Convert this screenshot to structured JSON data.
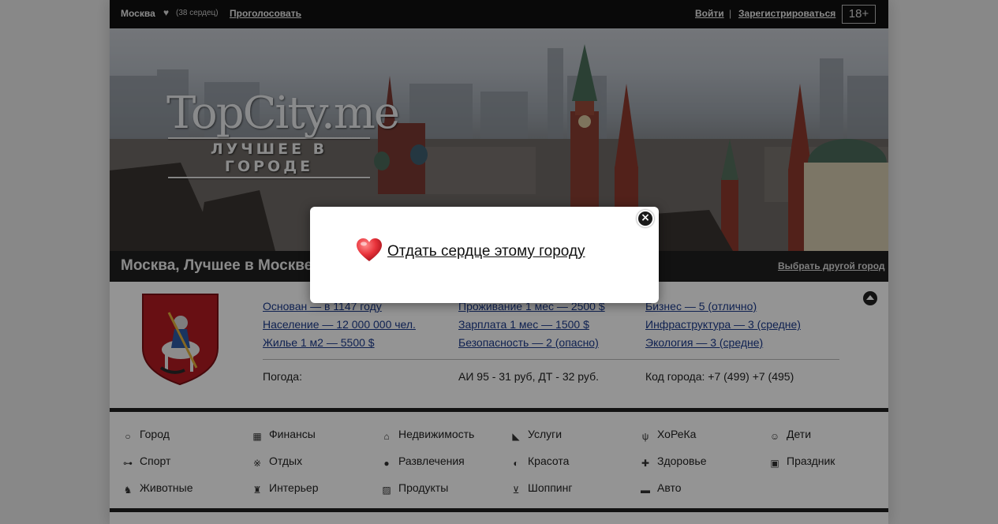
{
  "topbar": {
    "city": "Москва",
    "heart_icon": "heart-icon",
    "hearts_count": "(38 сердец)",
    "vote": "Проголосовать",
    "login": "Войти",
    "separator": "|",
    "register": "Зарегистрироваться",
    "age_badge": "18+"
  },
  "banner": {
    "logo_title": "TopCity.me",
    "logo_subtitle": "ЛУЧШЕЕ В ГОРОДЕ"
  },
  "citybar": {
    "title": "Москва, Лучшее в Москве",
    "choose_city": "Выбрать другой город"
  },
  "info": {
    "col1": [
      "Основан — в 1147 году",
      "Население — 12 000 000 чел.",
      "Жилье 1 м2 — 5500 $"
    ],
    "col2": [
      "Проживание 1 мес — 2500 $",
      "Зарплата 1 мес — 1500 $",
      "Безопасность — 2 (опасно)"
    ],
    "col3": [
      "Бизнес — 5 (отлично)",
      "Инфраструктура — 3 (средне)",
      "Экология — 3 (средне)"
    ],
    "weather": "Погода:",
    "fuel": "АИ 95 - 31 руб, ДТ - 32 руб.",
    "city_code": "Код города: +7 (499)  +7 (495)"
  },
  "categories": [
    {
      "label": "Город",
      "icon": "circle-icon",
      "glyph": "○"
    },
    {
      "label": "Финансы",
      "icon": "coins-icon",
      "glyph": "▦"
    },
    {
      "label": "Недвижимость",
      "icon": "house-icon",
      "glyph": "⌂"
    },
    {
      "label": "Услуги",
      "icon": "tag-icon",
      "glyph": "◣"
    },
    {
      "label": "ХоРеКа",
      "icon": "fork-knife-icon",
      "glyph": "ψ"
    },
    {
      "label": "Дети",
      "icon": "baby-icon",
      "glyph": "☺"
    },
    {
      "label": "Спорт",
      "icon": "dumbbell-icon",
      "glyph": "⊶"
    },
    {
      "label": "Отдых",
      "icon": "invader-icon",
      "glyph": "※"
    },
    {
      "label": "Развлечения",
      "icon": "ball-icon",
      "glyph": "●"
    },
    {
      "label": "Красота",
      "icon": "leaf-icon",
      "glyph": "◐"
    },
    {
      "label": "Здоровье",
      "icon": "cross-icon",
      "glyph": "✚"
    },
    {
      "label": "Праздник",
      "icon": "calendar-icon",
      "glyph": "▣"
    },
    {
      "label": "Животные",
      "icon": "animal-icon",
      "glyph": "♞"
    },
    {
      "label": "Интерьер",
      "icon": "lamp-icon",
      "glyph": "♜"
    },
    {
      "label": "Продукты",
      "icon": "box-icon",
      "glyph": "▨"
    },
    {
      "label": "Шоппинг",
      "icon": "cart-icon",
      "glyph": "⊻"
    },
    {
      "label": "Авто",
      "icon": "car-icon",
      "glyph": "▬"
    }
  ],
  "modal": {
    "give_heart": "Отдать сердце этому городу",
    "heart_icon": "heart-icon",
    "close_icon": "close-icon",
    "close_glyph": "×"
  },
  "colors": {
    "link": "#1a3a8c",
    "dark_bar": "#1f1f1f",
    "topbar": "#111111",
    "heart": "#e8323a"
  }
}
